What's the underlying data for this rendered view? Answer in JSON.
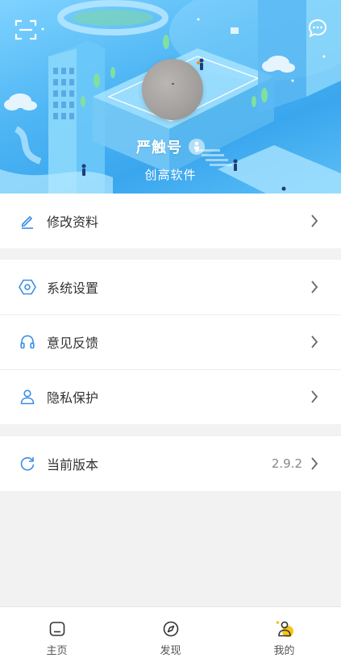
{
  "profile": {
    "name": "严触号",
    "company": "创高软件"
  },
  "menu": {
    "group1": [
      {
        "label": "修改资料",
        "icon": "edit-icon"
      }
    ],
    "group2": [
      {
        "label": "系统设置",
        "icon": "hexagon-settings-icon"
      },
      {
        "label": "意见反馈",
        "icon": "headphones-icon"
      },
      {
        "label": "隐私保护",
        "icon": "user-icon"
      }
    ],
    "group3": [
      {
        "label": "当前版本",
        "value": "2.9.2",
        "icon": "refresh-icon"
      }
    ]
  },
  "tabbar": {
    "tabs": [
      {
        "label": "主页",
        "icon": "home-icon",
        "active": false
      },
      {
        "label": "发现",
        "icon": "compass-icon",
        "active": false
      },
      {
        "label": "我的",
        "icon": "profile-icon",
        "active": true
      }
    ]
  },
  "colors": {
    "accent": "#3a8ee6",
    "header_blue": "#4fb6f4",
    "badge_yellow": "#f5c518"
  }
}
